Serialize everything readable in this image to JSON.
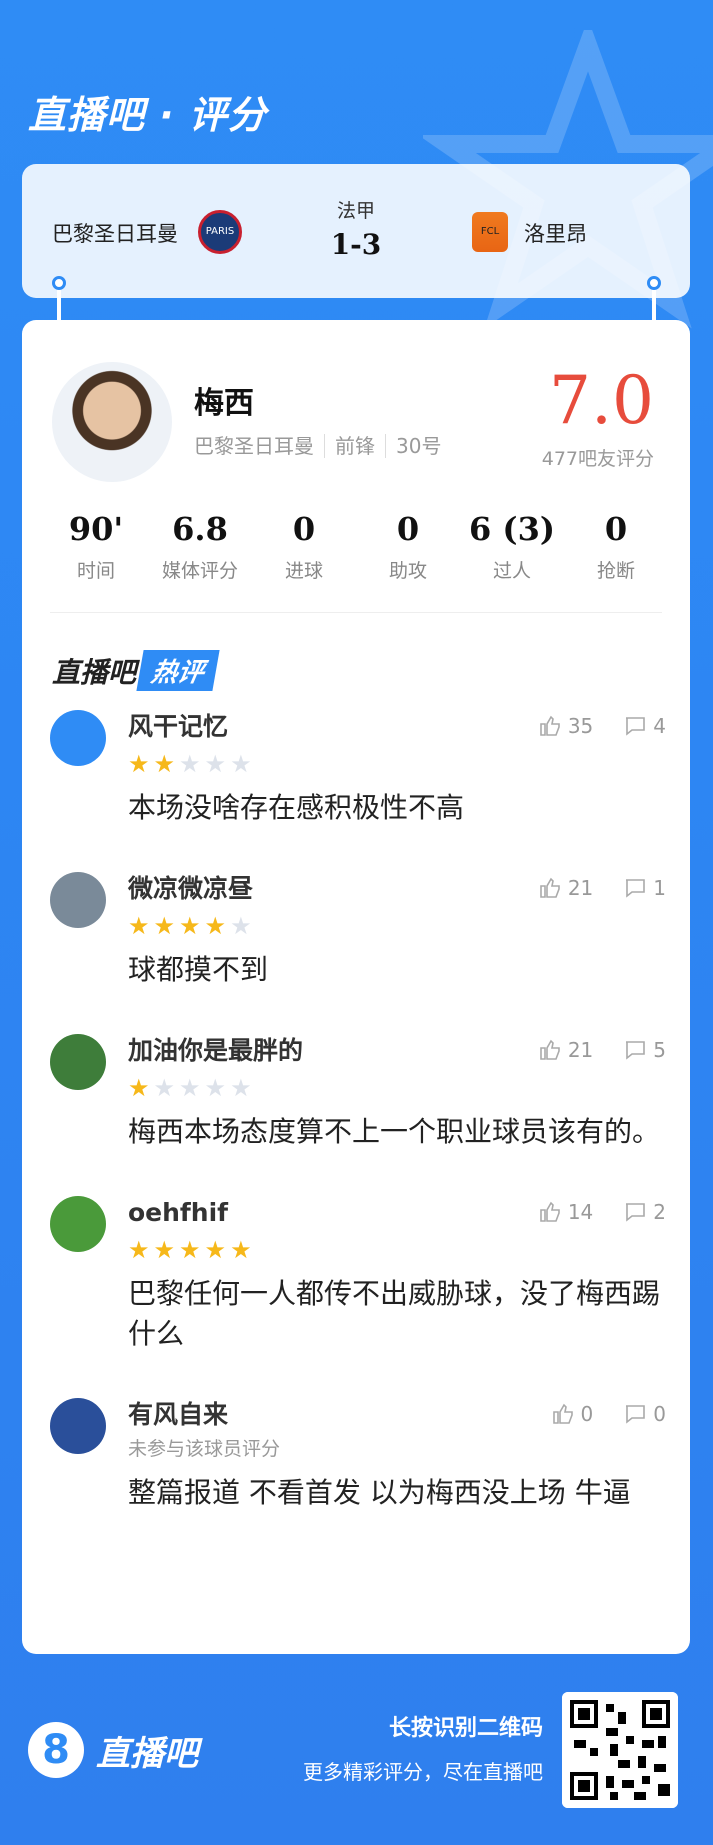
{
  "brand": {
    "title": "直播吧 · 评分"
  },
  "match": {
    "league": "法甲",
    "score": "1-3",
    "home_team": "巴黎圣日耳曼",
    "away_team": "洛里昂",
    "home_crest_text": "PARIS",
    "away_crest_text": "FCL"
  },
  "player": {
    "name": "梅西",
    "team": "巴黎圣日耳曼",
    "position": "前锋",
    "number": "30号",
    "rating": "7.0",
    "rating_count": "477吧友评分"
  },
  "stats": [
    {
      "value": "90'",
      "label": "时间"
    },
    {
      "value": "6.8",
      "label": "媒体评分"
    },
    {
      "value": "0",
      "label": "进球"
    },
    {
      "value": "0",
      "label": "助攻"
    },
    {
      "value": "6 (3)",
      "label": "过人"
    },
    {
      "value": "0",
      "label": "抢断"
    }
  ],
  "hot_section": {
    "prefix": "直播吧",
    "tag": "热评"
  },
  "comments": [
    {
      "user": "风干记忆",
      "stars": 2,
      "likes": "35",
      "replies": "4",
      "text": "本场没啥存在感积极性不高",
      "avatar_color": "#2f8cf5"
    },
    {
      "user": "微凉微凉昼",
      "stars": 4,
      "likes": "21",
      "replies": "1",
      "text": "球都摸不到",
      "avatar_color": "#7a8a99"
    },
    {
      "user": "加油你是最胖的",
      "stars": 1,
      "likes": "21",
      "replies": "5",
      "text": "梅西本场态度算不上一个职业球员该有的。",
      "avatar_color": "#3e7d3a"
    },
    {
      "user": "oehfhif",
      "stars": 5,
      "likes": "14",
      "replies": "2",
      "text": "巴黎任何一人都传不出威胁球，没了梅西踢什么",
      "avatar_color": "#4a9a3a"
    },
    {
      "user": "有风自来",
      "stars": 0,
      "sub": "未参与该球员评分",
      "likes": "0",
      "replies": "0",
      "text": "整篇报道 不看首发 以为梅西没上场 牛逼",
      "avatar_color": "#2a4f9a"
    }
  ],
  "footer": {
    "logo_mark": "8",
    "logo_text": "直播吧",
    "line1": "长按识别二维码",
    "line2": "更多精彩评分，尽在直播吧"
  }
}
